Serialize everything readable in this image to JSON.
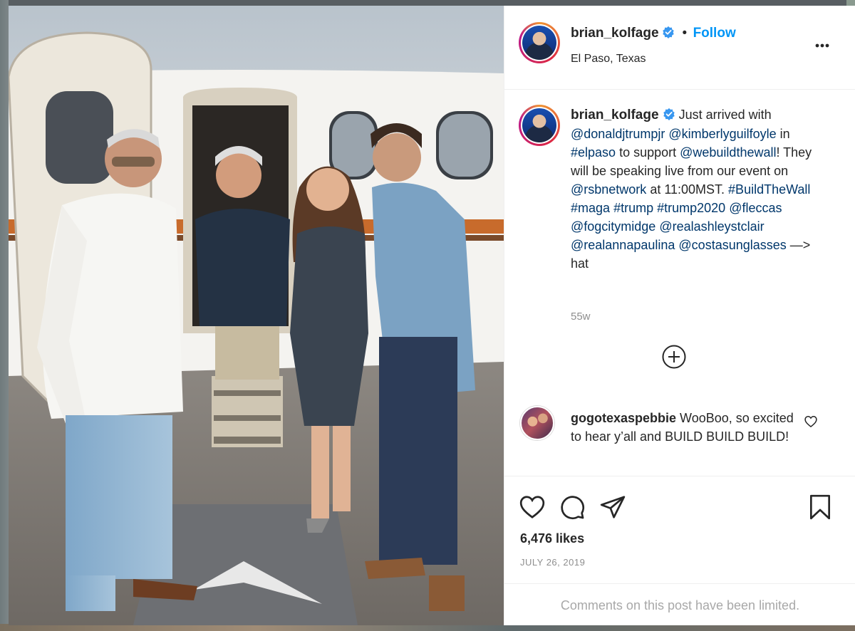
{
  "post": {
    "username": "brian_kolfage",
    "separator": "•",
    "follow_label": "Follow",
    "location": "El Paso, Texas",
    "caption": {
      "username": "brian_kolfage",
      "segments": [
        {
          "text": "Just arrived with ",
          "link": false
        },
        {
          "text": "@donaldjtrumpjr",
          "link": true
        },
        {
          "text": " ",
          "link": false
        },
        {
          "text": "@kimberlyguilfoyle",
          "link": true
        },
        {
          "text": " in ",
          "link": false
        },
        {
          "text": "#elpaso",
          "link": true
        },
        {
          "text": " to support ",
          "link": false
        },
        {
          "text": "@webuildthewall",
          "link": true
        },
        {
          "text": "! They will be speaking live from our event on ",
          "link": false
        },
        {
          "text": "@rsbnetwork",
          "link": true
        },
        {
          "text": " at 11:00MST. ",
          "link": false
        },
        {
          "text": "#BuildTheWall",
          "link": true
        },
        {
          "text": " ",
          "link": false
        },
        {
          "text": "#maga",
          "link": true
        },
        {
          "text": " ",
          "link": false
        },
        {
          "text": "#trump",
          "link": true
        },
        {
          "text": " ",
          "link": false
        },
        {
          "text": "#trump2020",
          "link": true
        },
        {
          "text": " ",
          "link": false
        },
        {
          "text": "@fleccas",
          "link": true
        },
        {
          "text": " ",
          "link": false
        },
        {
          "text": "@fogcitymidge",
          "link": true
        },
        {
          "text": " ",
          "link": false
        },
        {
          "text": "@realashleystclair",
          "link": true
        },
        {
          "text": " ",
          "link": false
        },
        {
          "text": "@realannapaulina",
          "link": true
        },
        {
          "text": " ",
          "link": false
        },
        {
          "text": "@costasunglasses",
          "link": true
        },
        {
          "text": " —> hat",
          "link": false
        }
      ]
    },
    "time_ago": "55w",
    "comment": {
      "username": "gogotexaspebbie",
      "text": "WooBoo, so excited to hear y’all and BUILD BUILD BUILD!"
    },
    "likes": "6,476 likes",
    "date": "JULY 26, 2019",
    "comments_limited": "Comments on this post have been limited."
  },
  "icons": {
    "verified": "verified-badge-icon",
    "more": "more-options-icon",
    "load_more": "plus-circle-icon",
    "comment_like": "heart-outline-icon",
    "like": "heart-icon",
    "comment": "comment-bubble-icon",
    "share": "paper-plane-icon",
    "save": "bookmark-icon"
  },
  "colors": {
    "accent": "#0095f6",
    "link": "#00376b",
    "text": "#262626",
    "muted": "#8e8e8e",
    "verified": "#3897f0"
  }
}
